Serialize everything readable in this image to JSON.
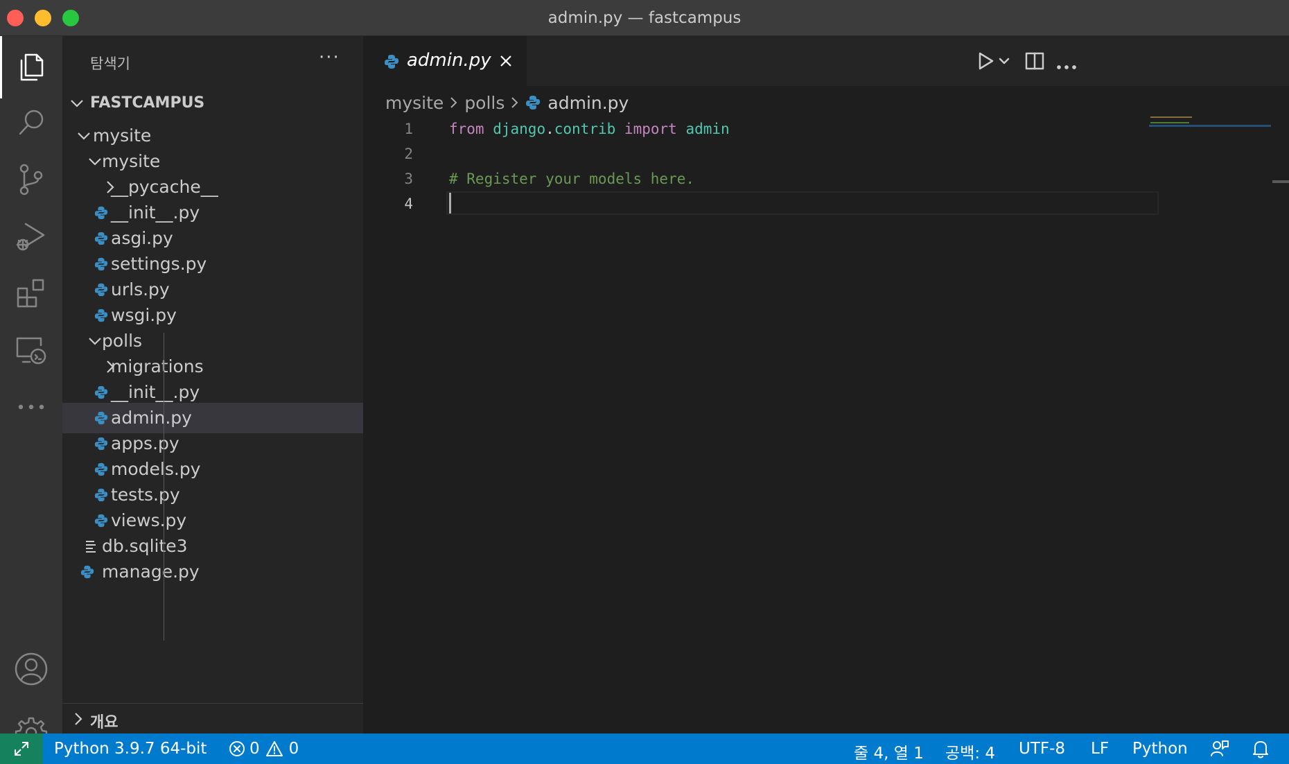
{
  "window": {
    "title": "admin.py — fastcampus"
  },
  "activity_bar": {
    "items": [
      {
        "icon": "files-icon",
        "active": true
      },
      {
        "icon": "search-icon"
      },
      {
        "icon": "source-control-icon"
      },
      {
        "icon": "run-debug-icon"
      },
      {
        "icon": "extensions-icon"
      },
      {
        "icon": "remote-explorer-icon"
      },
      {
        "icon": "more-icon"
      }
    ],
    "bottom": [
      {
        "icon": "account-icon"
      },
      {
        "icon": "settings-gear-icon"
      }
    ]
  },
  "sidebar": {
    "title": "탐색기",
    "more": "···",
    "section": "FASTCAMPUS",
    "tree": [
      {
        "label": "mysite",
        "kind": "folder-open"
      },
      {
        "label": "mysite",
        "kind": "folder-open"
      },
      {
        "label": "__pycache__",
        "kind": "folder-closed"
      },
      {
        "label": "__init__.py",
        "kind": "python"
      },
      {
        "label": "asgi.py",
        "kind": "python"
      },
      {
        "label": "settings.py",
        "kind": "python"
      },
      {
        "label": "urls.py",
        "kind": "python"
      },
      {
        "label": "wsgi.py",
        "kind": "python"
      },
      {
        "label": "polls",
        "kind": "folder-open"
      },
      {
        "label": "migrations",
        "kind": "folder-closed"
      },
      {
        "label": "__init__.py",
        "kind": "python"
      },
      {
        "label": "admin.py",
        "kind": "python",
        "selected": true
      },
      {
        "label": "apps.py",
        "kind": "python"
      },
      {
        "label": "models.py",
        "kind": "python"
      },
      {
        "label": "tests.py",
        "kind": "python"
      },
      {
        "label": "views.py",
        "kind": "python"
      },
      {
        "label": "db.sqlite3",
        "kind": "text"
      },
      {
        "label": "manage.py",
        "kind": "python"
      }
    ],
    "outline": "개요"
  },
  "tabs": [
    {
      "label": "admin.py",
      "active": true
    }
  ],
  "breadcrumb": {
    "parts": [
      "mysite",
      "polls"
    ],
    "file": "admin.py"
  },
  "editor": {
    "line_numbers": [
      "1",
      "2",
      "3",
      "4"
    ],
    "line1": {
      "kw1": "from",
      "mod1": "django",
      "dot": ".",
      "mod2": "contrib",
      "kw2": "import",
      "mod3": "admin"
    },
    "line3": {
      "comment": "# Register your models here."
    },
    "cursor": {
      "line": 4,
      "col": 1
    }
  },
  "statusbar": {
    "interpreter": "Python 3.9.7 64-bit",
    "errors": "0",
    "warnings": "0",
    "position": "줄 4, 열 1",
    "indent": "공백: 4",
    "encoding": "UTF-8",
    "eol": "LF",
    "language": "Python"
  },
  "colors": {
    "statusbar": "#007acc",
    "remote": "#16825d",
    "keyword": "#c586c0",
    "module": "#4ec9b0",
    "comment": "#6a9955"
  }
}
